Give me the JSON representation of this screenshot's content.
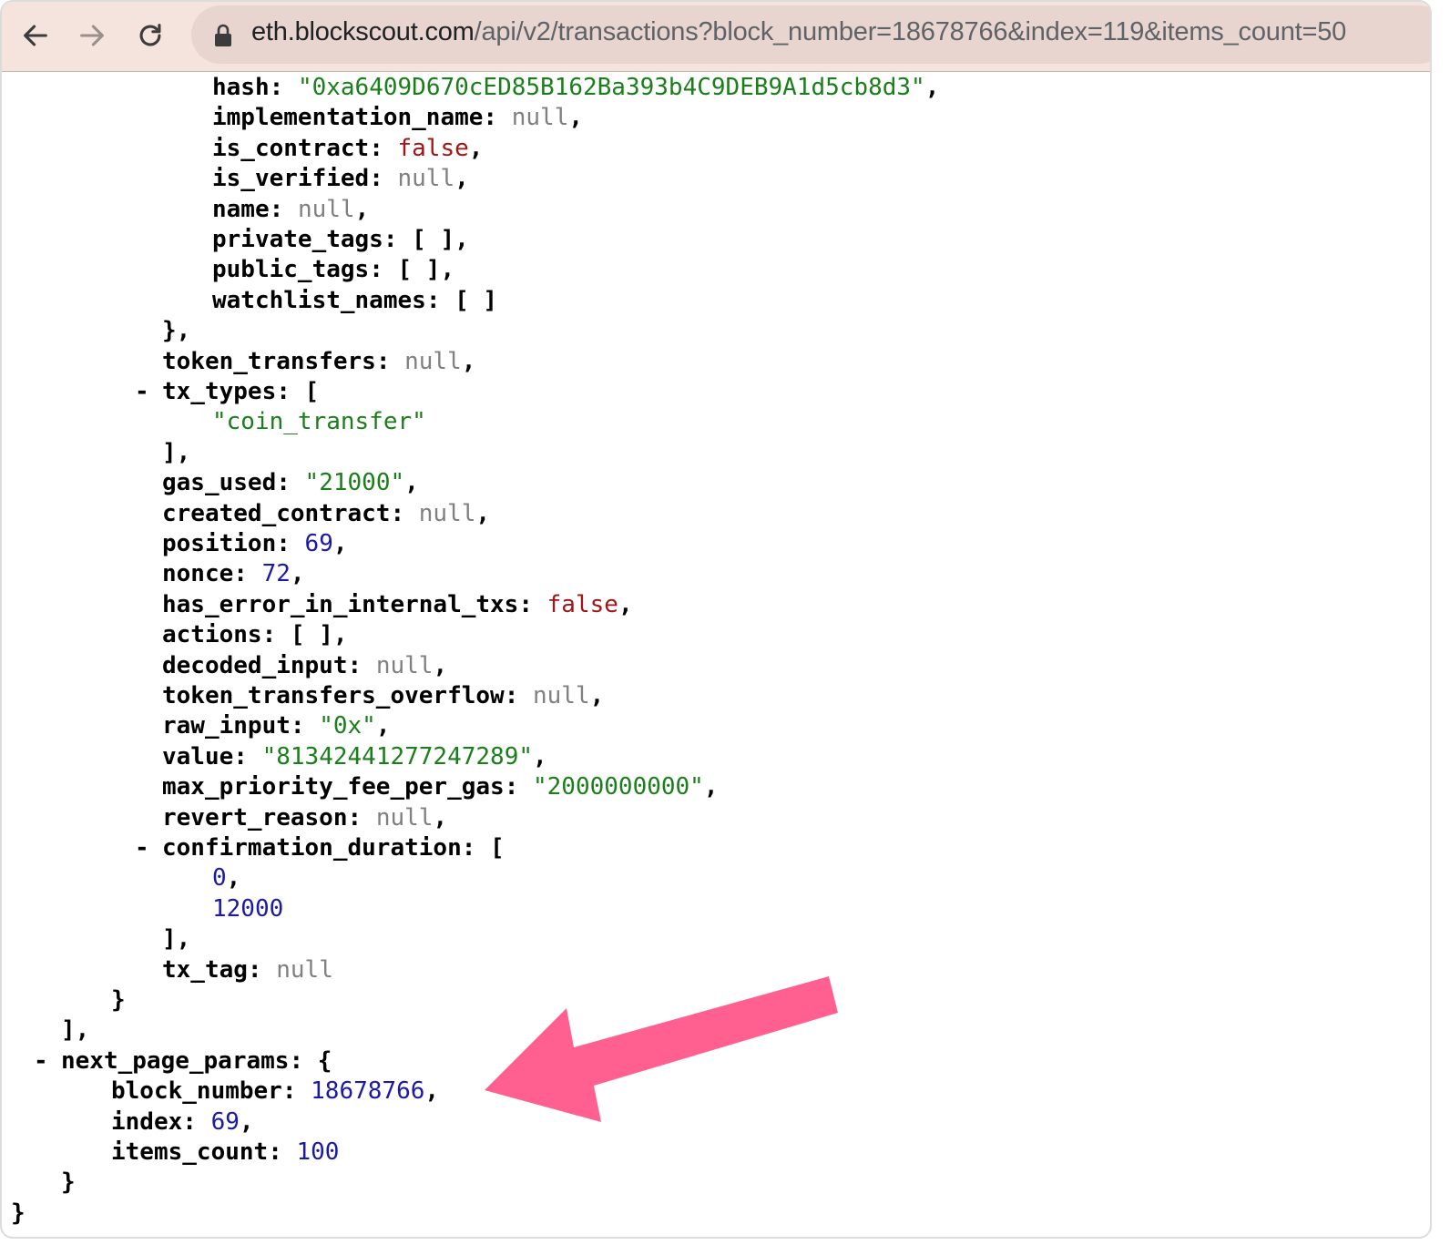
{
  "browser": {
    "url_host": "eth.blockscout.com",
    "url_path": "/api/v2/transactions?block_number=18678766&index=119&items_count=50"
  },
  "json_lines": [
    {
      "indent": 4,
      "toggle": false,
      "key": "hash",
      "value": "\"0xa6409D670cED85B162Ba393b4C9DEB9A1d5cb8d3\"",
      "vtype": "s",
      "tail": ","
    },
    {
      "indent": 4,
      "toggle": false,
      "key": "implementation_name",
      "value": "null",
      "vtype": "z",
      "tail": ","
    },
    {
      "indent": 4,
      "toggle": false,
      "key": "is_contract",
      "value": "false",
      "vtype": "b",
      "tail": ","
    },
    {
      "indent": 4,
      "toggle": false,
      "key": "is_verified",
      "value": "null",
      "vtype": "z",
      "tail": ","
    },
    {
      "indent": 4,
      "toggle": false,
      "key": "name",
      "value": "null",
      "vtype": "z",
      "tail": ","
    },
    {
      "indent": 4,
      "toggle": false,
      "key": "private_tags",
      "value": "[ ]",
      "vtype": "p",
      "tail": ","
    },
    {
      "indent": 4,
      "toggle": false,
      "key": "public_tags",
      "value": "[ ]",
      "vtype": "p",
      "tail": ","
    },
    {
      "indent": 4,
      "toggle": false,
      "key": "watchlist_names",
      "value": "[ ]",
      "vtype": "p",
      "tail": ""
    },
    {
      "indent": 3,
      "toggle": false,
      "key": "",
      "value": "},",
      "vtype": "p",
      "tail": ""
    },
    {
      "indent": 3,
      "toggle": false,
      "key": "token_transfers",
      "value": "null",
      "vtype": "z",
      "tail": ","
    },
    {
      "indent": 3,
      "toggle": true,
      "key": "tx_types",
      "value": "[",
      "vtype": "p",
      "tail": ""
    },
    {
      "indent": 4,
      "toggle": false,
      "key": "",
      "value": "\"coin_transfer\"",
      "vtype": "s",
      "tail": ""
    },
    {
      "indent": 3,
      "toggle": false,
      "key": "",
      "value": "],",
      "vtype": "p",
      "tail": ""
    },
    {
      "indent": 3,
      "toggle": false,
      "key": "gas_used",
      "value": "\"21000\"",
      "vtype": "s",
      "tail": ","
    },
    {
      "indent": 3,
      "toggle": false,
      "key": "created_contract",
      "value": "null",
      "vtype": "z",
      "tail": ","
    },
    {
      "indent": 3,
      "toggle": false,
      "key": "position",
      "value": "69",
      "vtype": "n",
      "tail": ","
    },
    {
      "indent": 3,
      "toggle": false,
      "key": "nonce",
      "value": "72",
      "vtype": "n",
      "tail": ","
    },
    {
      "indent": 3,
      "toggle": false,
      "key": "has_error_in_internal_txs",
      "value": "false",
      "vtype": "b",
      "tail": ","
    },
    {
      "indent": 3,
      "toggle": false,
      "key": "actions",
      "value": "[ ]",
      "vtype": "p",
      "tail": ","
    },
    {
      "indent": 3,
      "toggle": false,
      "key": "decoded_input",
      "value": "null",
      "vtype": "z",
      "tail": ","
    },
    {
      "indent": 3,
      "toggle": false,
      "key": "token_transfers_overflow",
      "value": "null",
      "vtype": "z",
      "tail": ","
    },
    {
      "indent": 3,
      "toggle": false,
      "key": "raw_input",
      "value": "\"0x\"",
      "vtype": "s",
      "tail": ","
    },
    {
      "indent": 3,
      "toggle": false,
      "key": "value",
      "value": "\"81342441277247289\"",
      "vtype": "s",
      "tail": ","
    },
    {
      "indent": 3,
      "toggle": false,
      "key": "max_priority_fee_per_gas",
      "value": "\"2000000000\"",
      "vtype": "s",
      "tail": ","
    },
    {
      "indent": 3,
      "toggle": false,
      "key": "revert_reason",
      "value": "null",
      "vtype": "z",
      "tail": ","
    },
    {
      "indent": 3,
      "toggle": true,
      "key": "confirmation_duration",
      "value": "[",
      "vtype": "p",
      "tail": ""
    },
    {
      "indent": 4,
      "toggle": false,
      "key": "",
      "value": "0",
      "vtype": "n",
      "tail": ","
    },
    {
      "indent": 4,
      "toggle": false,
      "key": "",
      "value": "12000",
      "vtype": "n",
      "tail": ""
    },
    {
      "indent": 3,
      "toggle": false,
      "key": "",
      "value": "],",
      "vtype": "p",
      "tail": ""
    },
    {
      "indent": 3,
      "toggle": false,
      "key": "tx_tag",
      "value": "null",
      "vtype": "z",
      "tail": ""
    },
    {
      "indent": 2,
      "toggle": false,
      "key": "",
      "value": "}",
      "vtype": "p",
      "tail": ""
    },
    {
      "indent": 1,
      "toggle": false,
      "key": "",
      "value": "],",
      "vtype": "p",
      "tail": ""
    },
    {
      "indent": 1,
      "toggle": true,
      "key": "next_page_params",
      "value": "{",
      "vtype": "p",
      "tail": ""
    },
    {
      "indent": 2,
      "toggle": false,
      "key": "block_number",
      "value": "18678766",
      "vtype": "n",
      "tail": ","
    },
    {
      "indent": 2,
      "toggle": false,
      "key": "index",
      "value": "69",
      "vtype": "n",
      "tail": ","
    },
    {
      "indent": 2,
      "toggle": false,
      "key": "items_count",
      "value": "100",
      "vtype": "n",
      "tail": ""
    },
    {
      "indent": 1,
      "toggle": false,
      "key": "",
      "value": "}",
      "vtype": "p",
      "tail": ""
    },
    {
      "indent": 0,
      "toggle": false,
      "key": "",
      "value": "}",
      "vtype": "p",
      "tail": ""
    }
  ],
  "toggle_symbol": "-",
  "annotation": {
    "arrow_color": "#ff6090"
  }
}
